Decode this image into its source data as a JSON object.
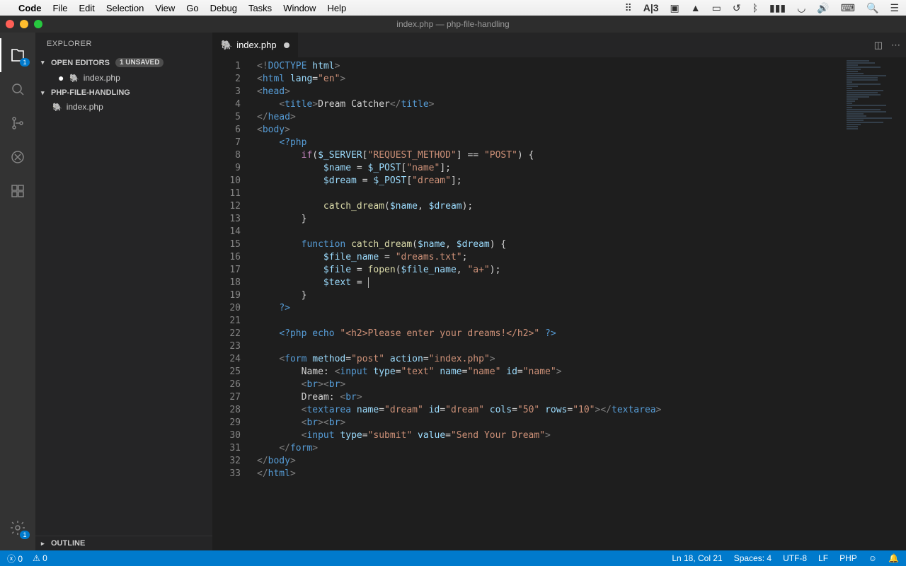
{
  "mac_menu": {
    "app": "Code",
    "items": [
      "File",
      "Edit",
      "Selection",
      "View",
      "Go",
      "Debug",
      "Tasks",
      "Window",
      "Help"
    ]
  },
  "titlebar": "index.php — php-file-handling",
  "sidebar": {
    "title": "EXPLORER",
    "open_editors": {
      "label": "OPEN EDITORS",
      "badge": "1 UNSAVED"
    },
    "open_files": [
      {
        "name": "index.php",
        "dirty": true
      }
    ],
    "folder": {
      "label": "PHP-FILE-HANDLING"
    },
    "files": [
      {
        "name": "index.php"
      }
    ],
    "outline": "OUTLINE"
  },
  "tab": {
    "name": "index.php",
    "dirty": true
  },
  "activity_badges": {
    "explorer": "1",
    "gear": "1"
  },
  "code": {
    "1": {
      "pre": "",
      "html": "<span class='t-br'>&lt;!</span><span class='t-tag'>DOCTYPE</span> <span class='t-attr'>html</span><span class='t-br'>&gt;</span>"
    },
    "2": {
      "pre": "",
      "html": "<span class='t-br'>&lt;</span><span class='t-tag'>html</span> <span class='t-attr'>lang</span>=<span class='t-str'>\"en\"</span><span class='t-br'>&gt;</span>"
    },
    "3": {
      "pre": "",
      "html": "<span class='t-br'>&lt;</span><span class='t-tag'>head</span><span class='t-br'>&gt;</span>"
    },
    "4": {
      "pre": "    ",
      "html": "<span class='t-br'>&lt;</span><span class='t-tag'>title</span><span class='t-br'>&gt;</span>Dream Catcher<span class='t-br'>&lt;/</span><span class='t-tag'>title</span><span class='t-br'>&gt;</span>"
    },
    "5": {
      "pre": "",
      "html": "<span class='t-br'>&lt;/</span><span class='t-tag'>head</span><span class='t-br'>&gt;</span>"
    },
    "6": {
      "pre": "",
      "html": "<span class='t-br'>&lt;</span><span class='t-tag'>body</span><span class='t-br'>&gt;</span>"
    },
    "7": {
      "pre": "    ",
      "html": "<span class='t-php'>&lt;?php</span>"
    },
    "8": {
      "pre": "        ",
      "html": "<span class='t-kw2'>if</span>(<span class='t-var'>$_SERVER</span>[<span class='t-str'>\"REQUEST_METHOD\"</span>] == <span class='t-str'>\"POST\"</span>) {"
    },
    "9": {
      "pre": "            ",
      "html": "<span class='t-var'>$name</span> = <span class='t-var'>$_POST</span>[<span class='t-str'>\"name\"</span>];"
    },
    "10": {
      "pre": "            ",
      "html": "<span class='t-var'>$dream</span> = <span class='t-var'>$_POST</span>[<span class='t-str'>\"dream\"</span>];"
    },
    "11": {
      "pre": "",
      "html": ""
    },
    "12": {
      "pre": "            ",
      "html": "<span class='t-fn'>catch_dream</span>(<span class='t-var'>$name</span>, <span class='t-var'>$dream</span>);"
    },
    "13": {
      "pre": "        ",
      "html": "}"
    },
    "14": {
      "pre": "",
      "html": ""
    },
    "15": {
      "pre": "        ",
      "html": "<span class='t-kw'>function</span> <span class='t-fn'>catch_dream</span>(<span class='t-var'>$name</span>, <span class='t-var'>$dream</span>) {"
    },
    "16": {
      "pre": "            ",
      "html": "<span class='t-var'>$file_name</span> = <span class='t-str'>\"dreams.txt\"</span>;"
    },
    "17": {
      "pre": "            ",
      "html": "<span class='t-var'>$file</span> = <span class='t-fn'>fopen</span>(<span class='t-var'>$file_name</span>, <span class='t-str'>\"a+\"</span>);"
    },
    "18": {
      "pre": "            ",
      "html": "<span class='t-var'>$text</span> = <span class='cursor'></span>"
    },
    "19": {
      "pre": "        ",
      "html": "}"
    },
    "20": {
      "pre": "    ",
      "html": "<span class='t-php'>?&gt;</span>"
    },
    "21": {
      "pre": "",
      "html": ""
    },
    "22": {
      "pre": "    ",
      "html": "<span class='t-php'>&lt;?php</span> <span class='t-kw'>echo</span> <span class='t-str'>\"&lt;h2&gt;Please enter your dreams!&lt;/h2&gt;\"</span> <span class='t-php'>?&gt;</span>"
    },
    "23": {
      "pre": "",
      "html": ""
    },
    "24": {
      "pre": "    ",
      "html": "<span class='t-br'>&lt;</span><span class='t-tag'>form</span> <span class='t-attr'>method</span>=<span class='t-str'>\"post\"</span> <span class='t-attr'>action</span>=<span class='t-str'>\"index.php\"</span><span class='t-br'>&gt;</span>"
    },
    "25": {
      "pre": "        ",
      "html": "Name: <span class='t-br'>&lt;</span><span class='t-tag'>input</span> <span class='t-attr'>type</span>=<span class='t-str'>\"text\"</span> <span class='t-attr'>name</span>=<span class='t-str'>\"name\"</span> <span class='t-attr'>id</span>=<span class='t-str'>\"name\"</span><span class='t-br'>&gt;</span>"
    },
    "26": {
      "pre": "        ",
      "html": "<span class='t-br'>&lt;</span><span class='t-tag'>br</span><span class='t-br'>&gt;&lt;</span><span class='t-tag'>br</span><span class='t-br'>&gt;</span>"
    },
    "27": {
      "pre": "        ",
      "html": "Dream: <span class='t-br'>&lt;</span><span class='t-tag'>br</span><span class='t-br'>&gt;</span>"
    },
    "28": {
      "pre": "        ",
      "html": "<span class='t-br'>&lt;</span><span class='t-tag'>textarea</span> <span class='t-attr'>name</span>=<span class='t-str'>\"dream\"</span> <span class='t-attr'>id</span>=<span class='t-str'>\"dream\"</span> <span class='t-attr'>cols</span>=<span class='t-str'>\"50\"</span> <span class='t-attr'>rows</span>=<span class='t-str'>\"10\"</span><span class='t-br'>&gt;&lt;/</span><span class='t-tag'>textarea</span><span class='t-br'>&gt;</span>"
    },
    "29": {
      "pre": "        ",
      "html": "<span class='t-br'>&lt;</span><span class='t-tag'>br</span><span class='t-br'>&gt;&lt;</span><span class='t-tag'>br</span><span class='t-br'>&gt;</span>"
    },
    "30": {
      "pre": "        ",
      "html": "<span class='t-br'>&lt;</span><span class='t-tag'>input</span> <span class='t-attr'>type</span>=<span class='t-str'>\"submit\"</span> <span class='t-attr'>value</span>=<span class='t-str'>\"Send Your Dream\"</span><span class='t-br'>&gt;</span>"
    },
    "31": {
      "pre": "    ",
      "html": "<span class='t-br'>&lt;/</span><span class='t-tag'>form</span><span class='t-br'>&gt;</span>"
    },
    "32": {
      "pre": "",
      "html": "<span class='t-br'>&lt;/</span><span class='t-tag'>body</span><span class='t-br'>&gt;</span>"
    },
    "33": {
      "pre": "",
      "html": "<span class='t-br'>&lt;/</span><span class='t-tag'>html</span><span class='t-br'>&gt;</span>"
    }
  },
  "line_count": 33,
  "status": {
    "errors": "0",
    "warnings": "0",
    "lncol": "Ln 18, Col 21",
    "spaces": "Spaces: 4",
    "encoding": "UTF-8",
    "eol": "LF",
    "lang": "PHP"
  }
}
